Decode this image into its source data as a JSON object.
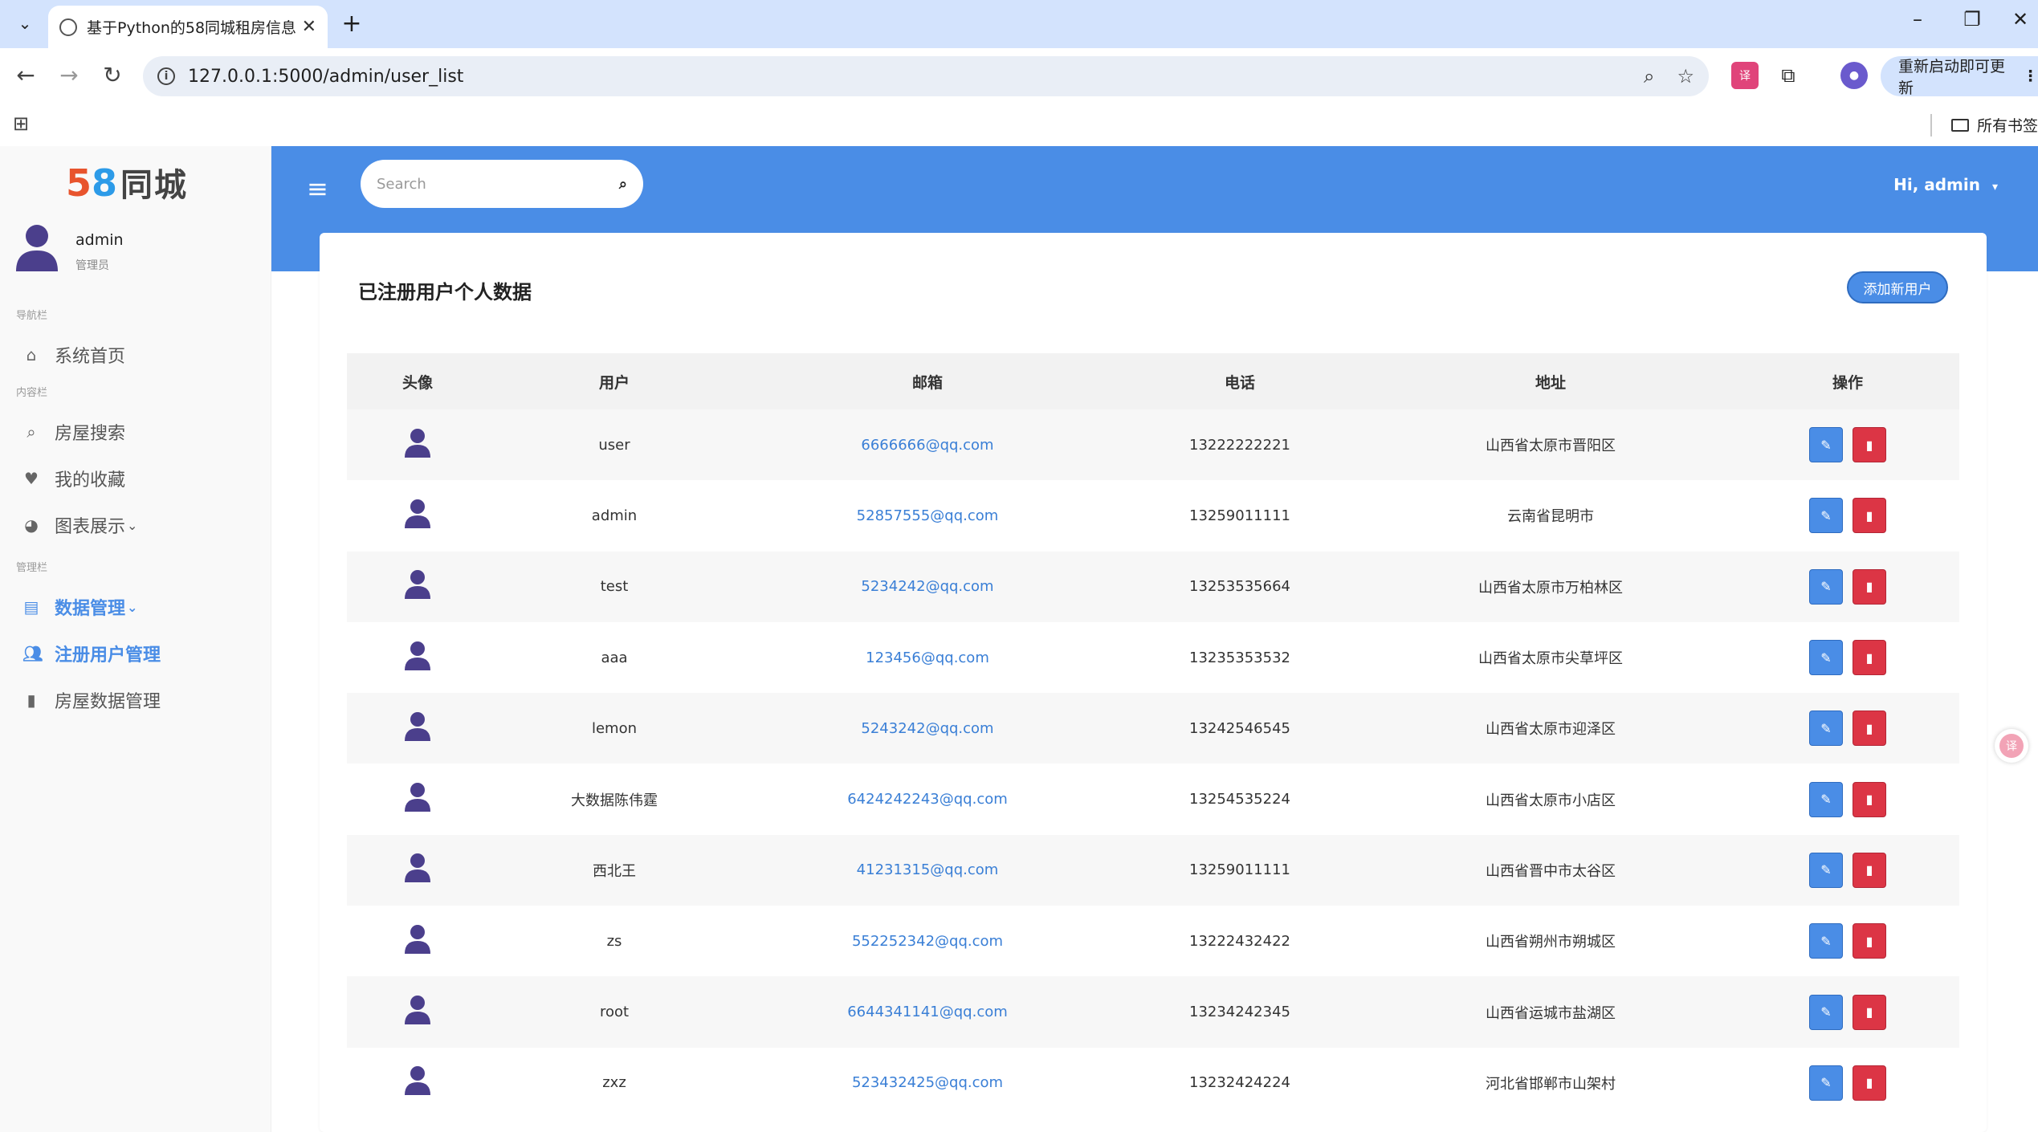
{
  "browser": {
    "tab_title": "基于Python的58同城租房信息",
    "url": "127.0.0.1:5000/admin/user_list",
    "update_button": "重新启动即可更新",
    "bookmarks_folder": "所有书签"
  },
  "sidebar": {
    "logo_digits_5": "5",
    "logo_digits_8": "8",
    "logo_text": "同城",
    "user_name": "admin",
    "user_role": "管理员",
    "section_nav": "导航栏",
    "section_content": "内容栏",
    "section_manage": "管理栏",
    "items": [
      {
        "label": "系统首页",
        "icon": "home-icon"
      },
      {
        "label": "房屋搜索",
        "icon": "search-icon"
      },
      {
        "label": "我的收藏",
        "icon": "heart-icon"
      },
      {
        "label": "图表展示",
        "icon": "pie-chart-icon"
      },
      {
        "label": "数据管理",
        "icon": "clipboard-icon"
      },
      {
        "label": "注册用户管理",
        "icon": "users-icon"
      },
      {
        "label": "房屋数据管理",
        "icon": "file-icon"
      }
    ]
  },
  "header": {
    "search_placeholder": "Search",
    "greeting": "Hi, admin"
  },
  "main": {
    "title": "已注册用户个人数据",
    "add_button": "添加新用户",
    "columns": [
      "头像",
      "用户",
      "邮箱",
      "电话",
      "地址",
      "操作"
    ],
    "rows": [
      {
        "user": "user",
        "email": "6666666@qq.com",
        "phone": "13222222221",
        "address": "山西省太原市晋阳区"
      },
      {
        "user": "admin",
        "email": "52857555@qq.com",
        "phone": "13259011111",
        "address": "云南省昆明市"
      },
      {
        "user": "test",
        "email": "5234242@qq.com",
        "phone": "13253535664",
        "address": "山西省太原市万柏林区"
      },
      {
        "user": "aaa",
        "email": "123456@qq.com",
        "phone": "13235353532",
        "address": "山西省太原市尖草坪区"
      },
      {
        "user": "lemon",
        "email": "5243242@qq.com",
        "phone": "13242546545",
        "address": "山西省太原市迎泽区"
      },
      {
        "user": "大数据陈伟霆",
        "email": "6424242243@qq.com",
        "phone": "13254535224",
        "address": "山西省太原市小店区"
      },
      {
        "user": "西北王",
        "email": "41231315@qq.com",
        "phone": "13259011111",
        "address": "山西省晋中市太谷区"
      },
      {
        "user": "zs",
        "email": "552252342@qq.com",
        "phone": "13222432422",
        "address": "山西省朔州市朔城区"
      },
      {
        "user": "root",
        "email": "6644341141@qq.com",
        "phone": "13234242345",
        "address": "山西省运城市盐湖区"
      },
      {
        "user": "zxz",
        "email": "523432425@qq.com",
        "phone": "13232424224",
        "address": "河北省邯郸市山架村"
      }
    ]
  },
  "colors": {
    "primary": "#4a8de6",
    "danger": "#dc3545",
    "avatar": "#4b3f8c"
  }
}
